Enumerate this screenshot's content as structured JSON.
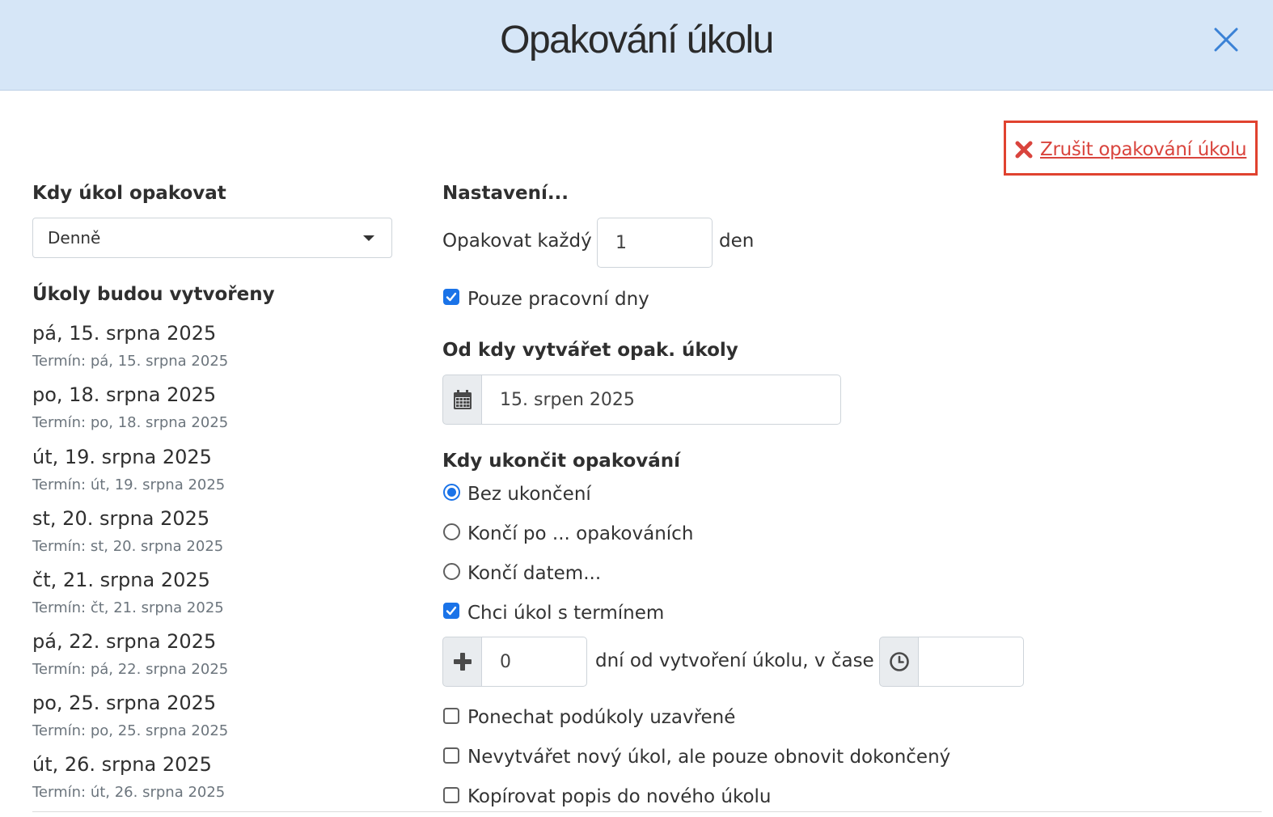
{
  "dialog": {
    "title": "Opakování úkolu",
    "close_icon": "close-icon"
  },
  "cancel_repeat": {
    "label": "Zrušit opakování úkolu",
    "icon": "x-mark-icon",
    "color": "#d9443d",
    "highlight_color": "#e0422f"
  },
  "left": {
    "when_heading": "Kdy úkol opakovat",
    "frequency_value": "Denně",
    "created_heading": "Úkoly budou vytvořeny",
    "occurrences": [
      {
        "date": "pá, 15. srpna 2025",
        "term": "Termín: pá, 15. srpna 2025"
      },
      {
        "date": "po, 18. srpna 2025",
        "term": "Termín: po, 18. srpna 2025"
      },
      {
        "date": "út, 19. srpna 2025",
        "term": "Termín: út, 19. srpna 2025"
      },
      {
        "date": "st, 20. srpna 2025",
        "term": "Termín: st, 20. srpna 2025"
      },
      {
        "date": "čt, 21. srpna 2025",
        "term": "Termín: čt, 21. srpna 2025"
      },
      {
        "date": "pá, 22. srpna 2025",
        "term": "Termín: pá, 22. srpna 2025"
      },
      {
        "date": "po, 25. srpna 2025",
        "term": "Termín: po, 25. srpna 2025"
      },
      {
        "date": "út, 26. srpna 2025",
        "term": "Termín: út, 26. srpna 2025"
      }
    ]
  },
  "settings": {
    "heading": "Nastavení...",
    "repeat_every_label": "Opakovat každý",
    "repeat_every_value": "1",
    "repeat_unit": "den",
    "workdays_only": {
      "label": "Pouze pracovní dny",
      "checked": true
    },
    "start_heading": "Od kdy vytvářet opak. úkoly",
    "start_date": "15. srpen 2025",
    "start_icon": "calendar-icon",
    "end_heading": "Kdy ukončit opakování",
    "end_options": [
      {
        "label": "Bez ukončení",
        "selected": true
      },
      {
        "label": "Končí po ... opakováních",
        "selected": false
      },
      {
        "label": "Končí datem...",
        "selected": false
      }
    ],
    "with_deadline": {
      "label": "Chci úkol s termínem",
      "checked": true
    },
    "deadline_days": "0",
    "deadline_days_icon": "plus-icon",
    "deadline_suffix": "dní od vytvoření úkolu, v čase",
    "deadline_time": "",
    "deadline_time_icon": "clock-icon",
    "options": [
      {
        "label": "Ponechat podúkoly uzavřené",
        "checked": false
      },
      {
        "label": "Nevytvářet nový úkol, ale pouze obnovit dokončený",
        "checked": false
      },
      {
        "label": "Kopírovat popis do nového úkolu",
        "checked": false
      }
    ]
  },
  "colors": {
    "header_bg": "#d6e6f7",
    "accent": "#1a73e8",
    "close_icon": "#3b82d6"
  }
}
